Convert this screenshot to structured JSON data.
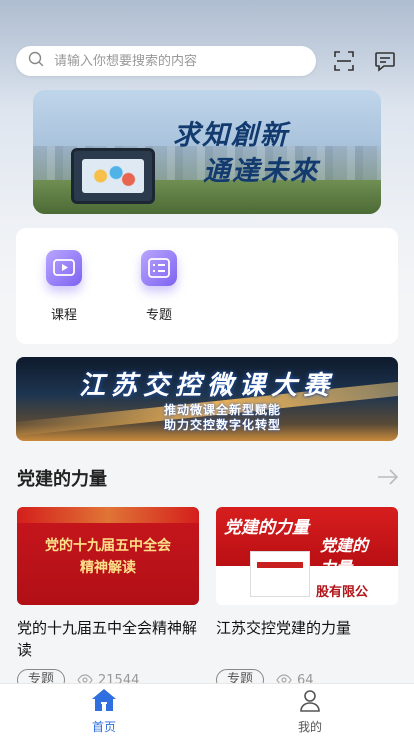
{
  "search": {
    "placeholder": "请输入你想要搜索的内容"
  },
  "icons": {
    "search": "search-icon",
    "scan": "scan-icon",
    "message": "message-icon"
  },
  "banner": {
    "slogan_line1": "求知創新",
    "slogan_line2": "通達未來"
  },
  "quick_entries": [
    {
      "label": "课程",
      "icon": "play-icon"
    },
    {
      "label": "专题",
      "icon": "list-icon"
    }
  ],
  "banner2": {
    "title": "江苏交控微课大赛",
    "sub_line1": "推动微课全新型赋能",
    "sub_line2": "助力交控数字化转型"
  },
  "section": {
    "title": "党建的力量"
  },
  "cards": [
    {
      "thumb_line1": "党的十九届五中全会",
      "thumb_line2": "精神解读",
      "title": "党的十九届五中全会精神解读",
      "tag": "专题",
      "views": "21544"
    },
    {
      "thumb_title": "党建的力量",
      "thumb_side1": "党建的",
      "thumb_side2": "力量",
      "thumb_company": "股有限公",
      "title": "江苏交控党建的力量",
      "tag": "专题",
      "views": "64"
    }
  ],
  "tabbar": {
    "tabs": [
      {
        "label": "首页",
        "active": true
      },
      {
        "label": "我的",
        "active": false
      }
    ]
  },
  "colors": {
    "accent": "#2f6fe0",
    "tab_inactive": "#555555",
    "card_red": "#c8161d",
    "icon_purple": "#7d63f2"
  }
}
